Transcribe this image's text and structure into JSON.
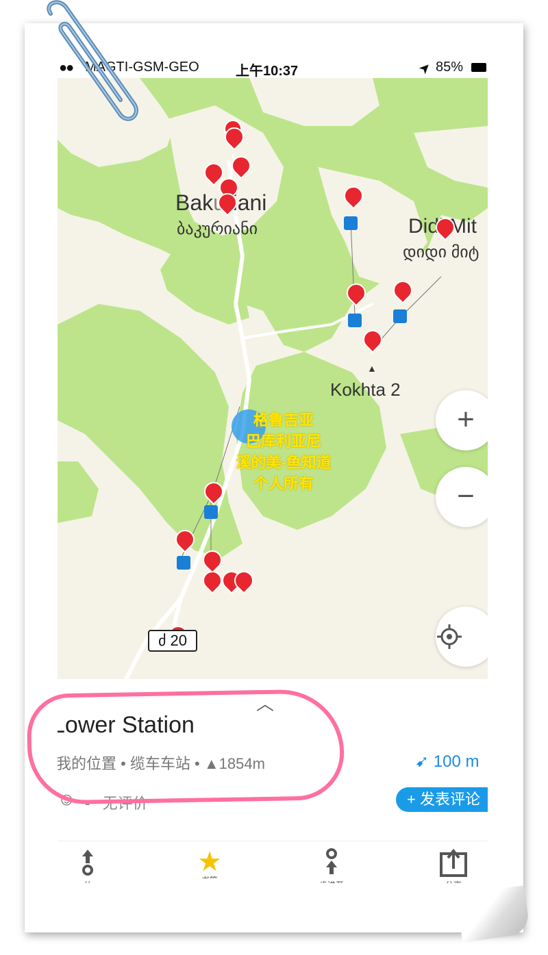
{
  "status_bar": {
    "signal": "●●",
    "carrier": "MAGTI-GSM-GEO",
    "time": "上午10:37",
    "location_arrow": "➤",
    "battery": "85%"
  },
  "map": {
    "place_labels": [
      {
        "name": "Bakuriani",
        "display": "Bak",
        "display2": "riani",
        "native": "ბაკურიანი"
      },
      {
        "name": "Didi Mitarbi",
        "display": "Didi Mit",
        "native": "დიდი მიტ"
      },
      {
        "name": "Kokhta 2",
        "display": "Kokhta 2"
      }
    ],
    "road_label": "ძ 20",
    "watermark_lines": [
      "格鲁吉亚",
      "巴库利亚尼",
      "溪的美-鱼知道",
      "个人所有"
    ],
    "zoom_in_label": "+",
    "zoom_out_label": "−",
    "locate_icon": "crosshair-icon",
    "colors": {
      "forest": "#bde48a",
      "land": "#f5f3e8",
      "pin": "#e8262f",
      "lift_station": "#1a7fd6",
      "location_dot": "#3aa0f0"
    }
  },
  "sheet": {
    "title": "Lower Station",
    "title_display": "Lower Station",
    "meta": "我的位置 • 缆车车站 • ▲1854m",
    "distance": "100 m",
    "rating_dash": "-",
    "rating_text": "无评价",
    "review_button": "+ 发表评论"
  },
  "tabs": [
    {
      "label": "从",
      "icon": "route-from-icon"
    },
    {
      "label": "书签",
      "icon": "star-icon"
    },
    {
      "label": "步进至",
      "icon": "route-to-icon"
    },
    {
      "label": "分享",
      "icon": "share-icon"
    }
  ]
}
